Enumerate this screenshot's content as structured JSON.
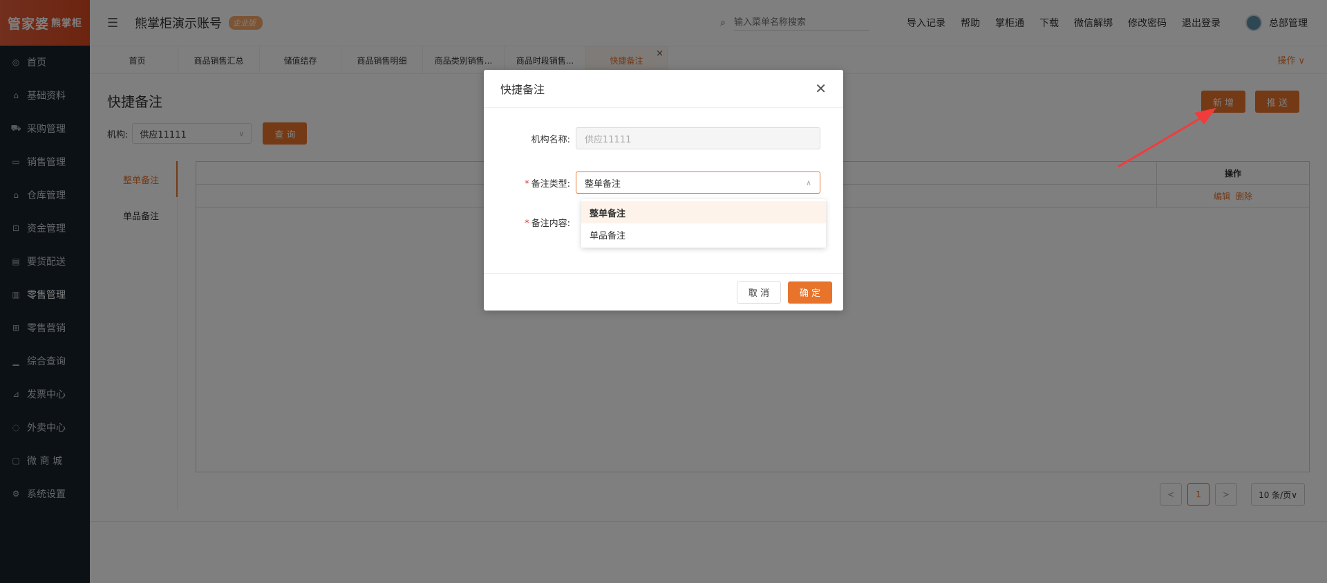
{
  "logo": {
    "main": "管家婆",
    "sub": "熊掌柜"
  },
  "sidebar": {
    "items": [
      {
        "icon": "globe-icon",
        "glyph": "◎",
        "label": "首页"
      },
      {
        "icon": "home-icon",
        "glyph": "⌂",
        "label": "基础资料"
      },
      {
        "icon": "cart-icon",
        "glyph": "⛟",
        "label": "采购管理"
      },
      {
        "icon": "sales-icon",
        "glyph": "▭",
        "label": "销售管理"
      },
      {
        "icon": "warehouse-icon",
        "glyph": "⌂",
        "label": "仓库管理"
      },
      {
        "icon": "finance-icon",
        "glyph": "⊡",
        "label": "资金管理"
      },
      {
        "icon": "delivery-icon",
        "glyph": "▤",
        "label": "要货配送"
      },
      {
        "icon": "retail-icon",
        "glyph": "▥",
        "label": "零售管理"
      },
      {
        "icon": "gift-icon",
        "glyph": "⊞",
        "label": "零售营销"
      },
      {
        "icon": "bar-chart-icon",
        "glyph": "▁",
        "label": "综合查询"
      },
      {
        "icon": "invoice-icon",
        "glyph": "⊿",
        "label": "发票中心"
      },
      {
        "icon": "takeout-icon",
        "glyph": "◌",
        "label": "外卖中心"
      },
      {
        "icon": "shop-icon",
        "glyph": "▢",
        "label": "微 商 城"
      },
      {
        "icon": "gear-icon",
        "glyph": "⚙",
        "label": "系统设置"
      }
    ]
  },
  "header": {
    "account_name": "熊掌柜演示账号",
    "badge": "企业版",
    "search_placeholder": "输入菜单名称搜索",
    "links": [
      "导入记录",
      "帮助",
      "掌柜通",
      "下载",
      "微信解绑",
      "修改密码",
      "退出登录"
    ],
    "user_name": "总部管理"
  },
  "tabs": {
    "items": [
      "首页",
      "商品销售汇总",
      "储值结存",
      "商品销售明细",
      "商品类别销售...",
      "商品时段销售...",
      "快捷备注"
    ],
    "close_glyph": "×",
    "operation_label": "操作 ∨"
  },
  "page": {
    "title": "快捷备注",
    "org_label": "机构:",
    "org_value": "供应11111",
    "query_button": "查 询",
    "add_button": "新 增",
    "push_button": "推 送",
    "side_tabs": [
      "整单备注",
      "单品备注"
    ],
    "table": {
      "op_header": "操作",
      "row_actions": [
        "编辑",
        "删除"
      ]
    },
    "pagination": {
      "prev": "<",
      "current": "1",
      "next": ">",
      "page_size": "10 条/页∨"
    }
  },
  "modal": {
    "title": "快捷备注",
    "close_glyph": "✕",
    "org_name_label": "机构名称:",
    "org_name_value": "供应11111",
    "note_type_label": "备注类型:",
    "note_type_value": "整单备注",
    "note_content_label": "备注内容:",
    "options": [
      "整单备注",
      "单品备注"
    ],
    "cancel": "取 消",
    "confirm": "确 定"
  },
  "colors": {
    "accent": "#e8742c",
    "sidebar_bg": "#19222d",
    "annotation_arrow": "#f03c3c"
  }
}
